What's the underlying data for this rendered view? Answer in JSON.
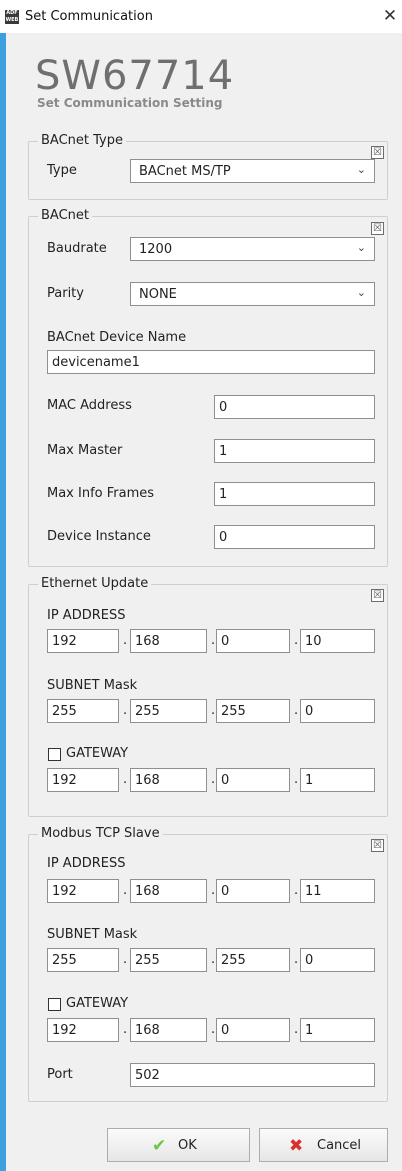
{
  "window": {
    "title": "Set Communication",
    "close_glyph": "✕",
    "icon_text": "ADF WEB"
  },
  "header": {
    "product": "SW67714",
    "subtitle": "Set Communication Setting"
  },
  "collapse_glyph": "☒",
  "bacnet_type": {
    "legend": "BACnet Type",
    "type_label": "Type",
    "type_value": "BACnet MS/TP"
  },
  "bacnet": {
    "legend": "BACnet",
    "baudrate_label": "Baudrate",
    "baudrate_value": "1200",
    "parity_label": "Parity",
    "parity_value": "NONE",
    "device_name_label": "BACnet Device Name",
    "device_name_value": "devicename1",
    "mac_label": "MAC Address",
    "mac_value": "0",
    "max_master_label": "Max Master",
    "max_master_value": "1",
    "max_info_label": "Max Info Frames",
    "max_info_value": "1",
    "instance_label": "Device Instance",
    "instance_value": "0"
  },
  "ethernet": {
    "legend": "Ethernet Update",
    "ip_label": "IP ADDRESS",
    "ip": [
      "192",
      "168",
      "0",
      "10"
    ],
    "mask_label": "SUBNET Mask",
    "mask": [
      "255",
      "255",
      "255",
      "0"
    ],
    "gateway_label": "GATEWAY",
    "gateway_checked": false,
    "gateway": [
      "192",
      "168",
      "0",
      "1"
    ]
  },
  "modbus": {
    "legend": "Modbus TCP Slave",
    "ip_label": "IP ADDRESS",
    "ip": [
      "192",
      "168",
      "0",
      "11"
    ],
    "mask_label": "SUBNET Mask",
    "mask": [
      "255",
      "255",
      "255",
      "0"
    ],
    "gateway_label": "GATEWAY",
    "gateway_checked": false,
    "gateway": [
      "192",
      "168",
      "0",
      "1"
    ],
    "port_label": "Port",
    "port_value": "502"
  },
  "buttons": {
    "ok": "OK",
    "cancel": "Cancel",
    "ok_icon": "check-icon",
    "cancel_icon": "cross-icon"
  },
  "colors": {
    "accent": "#3da0de",
    "ok_green": "#6cc644",
    "cancel_red": "#d9302c"
  },
  "ip_separator": "."
}
